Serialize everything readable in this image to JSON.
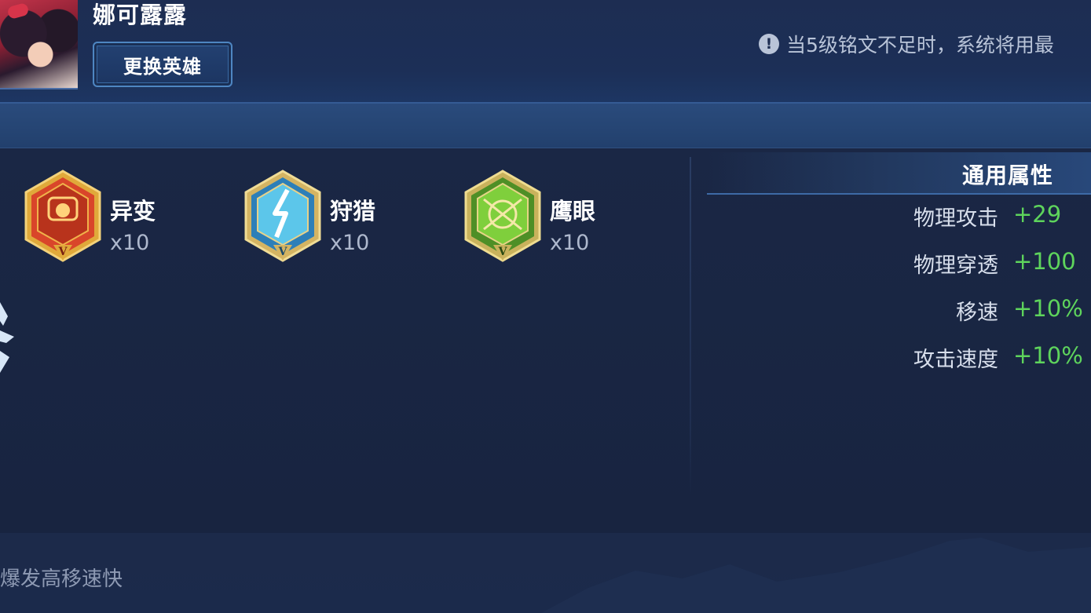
{
  "header": {
    "hero_name": "娜可露露",
    "change_hero_label": "更换英雄",
    "notice_icon": "!",
    "notice_text": "当5级铭文不足时，系统将用最"
  },
  "runes": [
    {
      "name": "异变",
      "count": "x10",
      "tier": "V",
      "color": "red",
      "icon": "mutation-rune-icon"
    },
    {
      "name": "狩猎",
      "count": "x10",
      "tier": "V",
      "color": "blue",
      "icon": "hunt-rune-icon"
    },
    {
      "name": "鹰眼",
      "count": "x10",
      "tier": "V",
      "color": "green",
      "icon": "hawkeye-rune-icon"
    }
  ],
  "attributes": {
    "title": "通用属性",
    "rows": [
      {
        "label": "物理攻击",
        "value": "+29"
      },
      {
        "label": "物理穿透",
        "value": "+100"
      },
      {
        "label": "移速",
        "value": "+10%"
      },
      {
        "label": "攻击速度",
        "value": "+10%"
      }
    ]
  },
  "footer": {
    "text": "爆发高移速快"
  },
  "colors": {
    "background": "#1a2542",
    "accent_border": "#4e86c2",
    "value_green": "#5ed45c",
    "rune_red": "#d9452a",
    "rune_blue": "#3aa7d6",
    "rune_green": "#6fbf34"
  }
}
